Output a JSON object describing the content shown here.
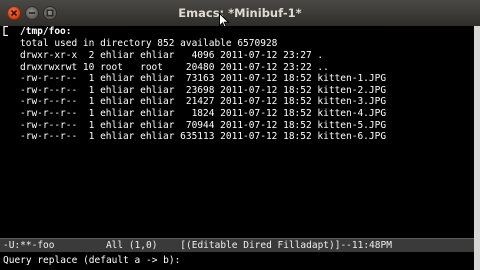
{
  "window": {
    "title": "Emacs: *Minibuf-1*",
    "buttons": [
      "close-icon",
      "minimize-icon",
      "maximize-icon"
    ],
    "colors": {
      "titlebar": "#3c3b37",
      "close_button": "#e05a2b",
      "buffer_background": "#000000",
      "buffer_text": "#ffffff",
      "modeline_background": "#3a3a3a"
    }
  },
  "dired": {
    "directory": "/tmp/foo:",
    "total_line": "total used in directory 852 available 6570928",
    "columns": [
      "permissions",
      "links",
      "owner",
      "group",
      "size",
      "date",
      "time",
      "name"
    ],
    "rows": [
      {
        "text": "drwxr-xr-x  2 ehliar ehliar   4096 2011-07-12 23:27 ."
      },
      {
        "text": "drwxrwxrwt 10 root   root    20480 2011-07-12 23:22 .."
      },
      {
        "text": "-rw-r--r--  1 ehliar ehliar  73163 2011-07-12 18:52 kitten-1.JPG"
      },
      {
        "text": "-rw-r--r--  1 ehliar ehliar  23698 2011-07-12 18:52 kitten-2.JPG"
      },
      {
        "text": "-rw-r--r--  1 ehliar ehliar  21427 2011-07-12 18:52 kitten-3.JPG"
      },
      {
        "text": "-rw-r--r--  1 ehliar ehliar   1824 2011-07-12 18:52 kitten-4.JPG"
      },
      {
        "text": "-rw-r--r--  1 ehliar ehliar  70944 2011-07-12 18:52 kitten-5.JPG"
      },
      {
        "text": "-rw-r--r--  1 ehliar ehliar 635113 2011-07-12 18:52 kitten-6.JPG"
      }
    ]
  },
  "modeline": {
    "text": "-U:**-foo         All (1,0)    [(Editable Dired Filladapt)]--11:48PM"
  },
  "minibuffer": {
    "prompt": "Query replace (default a -> b):"
  }
}
